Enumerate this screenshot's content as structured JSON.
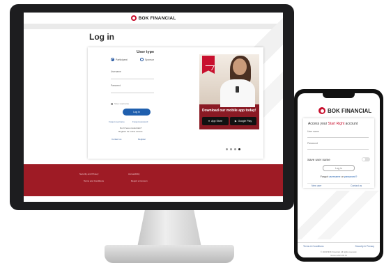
{
  "brand": {
    "name": "BOK FINANCIAL",
    "accent_color": "#c8102e",
    "footer_color": "#9e1b25",
    "button_color": "#1f5fae"
  },
  "desktop": {
    "page_title": "Log in",
    "user_type": {
      "title": "User type",
      "options": [
        "Participant",
        "Sponsor"
      ],
      "selected": "Participant"
    },
    "fields": {
      "username_label": "Username",
      "password_label": "Password"
    },
    "remember_label": "Save username",
    "login_button": "Log in",
    "forgot_username": "Forgot username",
    "forgot_password": "Forgot password",
    "no_account": "Don't have credentials?",
    "register": "Register for online access",
    "contact_us": "Contact us",
    "register_link": "Register",
    "ad": {
      "headline": "Download our mobile app today!",
      "app_store": "App Store",
      "google_play": "Google Play",
      "carousel_active_index": 3
    },
    "footer": {
      "links": [
        "Security and Privacy",
        "Terms and Conditions",
        "Accessibility",
        "Report a Concern"
      ]
    }
  },
  "mobile": {
    "brand": "BOK FINANCIAL",
    "access_prefix": "Access your ",
    "access_highlight": "Start Right",
    "access_suffix": " account",
    "username_label": "User name",
    "password_label": "Password",
    "save_username": "Save user name",
    "login_button": "Log in",
    "forgot_prefix": "Forgot ",
    "forgot_username": "username",
    "forgot_or": " or ",
    "forgot_password": "password?",
    "new_user": "New user",
    "contact_us": "Contact us",
    "footer_links": [
      "Terms & Conditions",
      "Security & Privacy"
    ],
    "copyright": "© 2023 BOK Financial. All rights reserved.",
    "version": "Version 2023.06.01"
  }
}
